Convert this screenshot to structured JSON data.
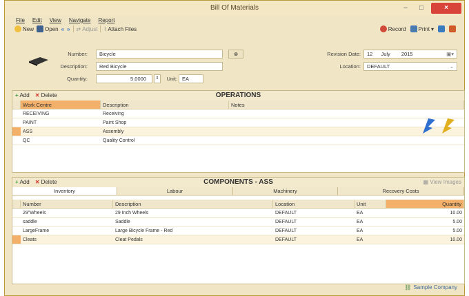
{
  "window": {
    "title": "Bill Of Materials",
    "min": "–",
    "max": "□",
    "close": "×"
  },
  "menu": [
    "File",
    "Edit",
    "View",
    "Navigate",
    "Report"
  ],
  "toolbar": {
    "new": "New",
    "open": "Open",
    "adjust": "Adjust",
    "attach": "Attach Files",
    "record": "Record",
    "print": "Print"
  },
  "form": {
    "number_label": "Number:",
    "number_value": "Bicycle",
    "description_label": "Description:",
    "description_value": "Red Bicycle",
    "quantity_label": "Quantity:",
    "quantity_value": "5.0000",
    "unit_label": "Unit:",
    "unit_value": "EA",
    "revision_label": "Revision Date:",
    "revision_day": "12",
    "revision_month": "July",
    "revision_year": "2015",
    "location_label": "Location:",
    "location_value": "DEFAULT"
  },
  "operations": {
    "add": "Add",
    "delete": "Delete",
    "title": "OPERATIONS",
    "columns": [
      "Work Centre",
      "Description",
      "Notes"
    ],
    "rows": [
      [
        "RECEIVING",
        "Receiving",
        ""
      ],
      [
        "PAINT",
        "Paint Shop",
        ""
      ],
      [
        "ASS",
        "Assembly",
        ""
      ],
      [
        "QC",
        "Quality Control",
        ""
      ]
    ]
  },
  "components": {
    "add": "Add",
    "delete": "Delete",
    "title": "COMPONENTS - ASS",
    "view_images": "View Images",
    "tabs": [
      "Inventory",
      "Labour",
      "Machinery",
      "Recovery Costs"
    ],
    "columns": [
      "Number",
      "Description",
      "Location",
      "Unit",
      "Quantity"
    ],
    "rows": [
      [
        "29\"Wheels",
        "29 Inch Wheels",
        "DEFAULT",
        "EA",
        "10.00"
      ],
      [
        "saddle",
        "Saddle",
        "DEFAULT",
        "EA",
        "5.00"
      ],
      [
        "LargeFrame",
        "Large Bicycle Frame - Red",
        "DEFAULT",
        "EA",
        "5.00"
      ],
      [
        "Cleats",
        "Cleat Pedals",
        "DEFAULT",
        "EA",
        "10.00"
      ]
    ]
  },
  "status": {
    "company": "Sample Company"
  },
  "colors": {
    "accent": "#f2b06b",
    "close": "#d9443a"
  }
}
